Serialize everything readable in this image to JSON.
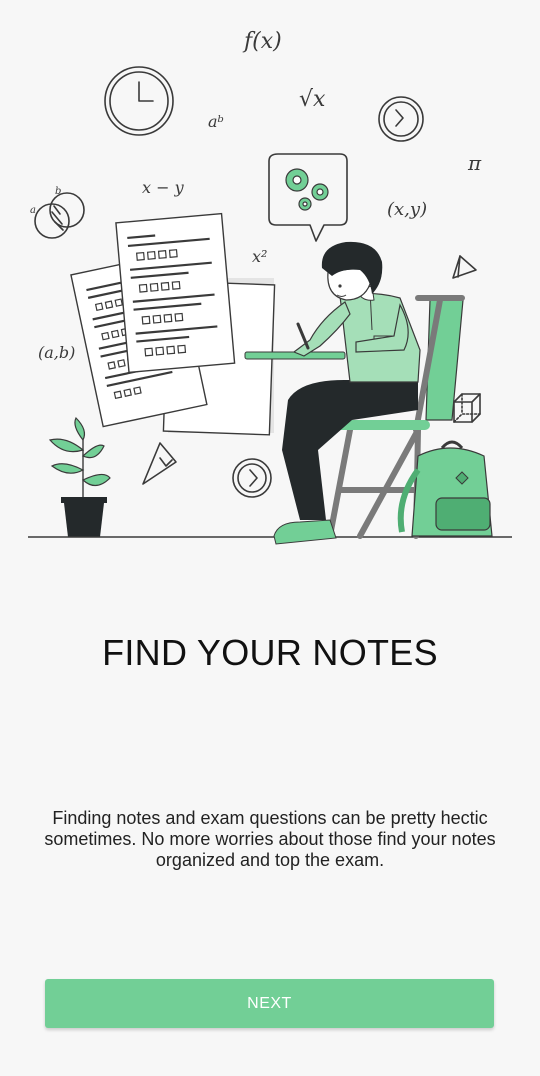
{
  "onboarding": {
    "title": "FIND YOUR NOTES",
    "description": "Finding notes and exam questions can be pretty hectic sometimes. No more worries about those find your notes organized and top the exam.",
    "next_label": "NEXT"
  },
  "illustration": {
    "doodles": {
      "fx": "f(x)",
      "ab_power": "aᵇ",
      "sqrt": "√x",
      "x_minus_y": "x − y",
      "x_squared": "x²",
      "xy_pair": "(x,y)",
      "ab_pair": "(a,b)",
      "pi": "π",
      "venn_a": "a",
      "venn_b": "b"
    }
  },
  "colors": {
    "accent": "#72cf96",
    "accent_dark": "#4fae73",
    "ink": "#3a3a3a"
  }
}
